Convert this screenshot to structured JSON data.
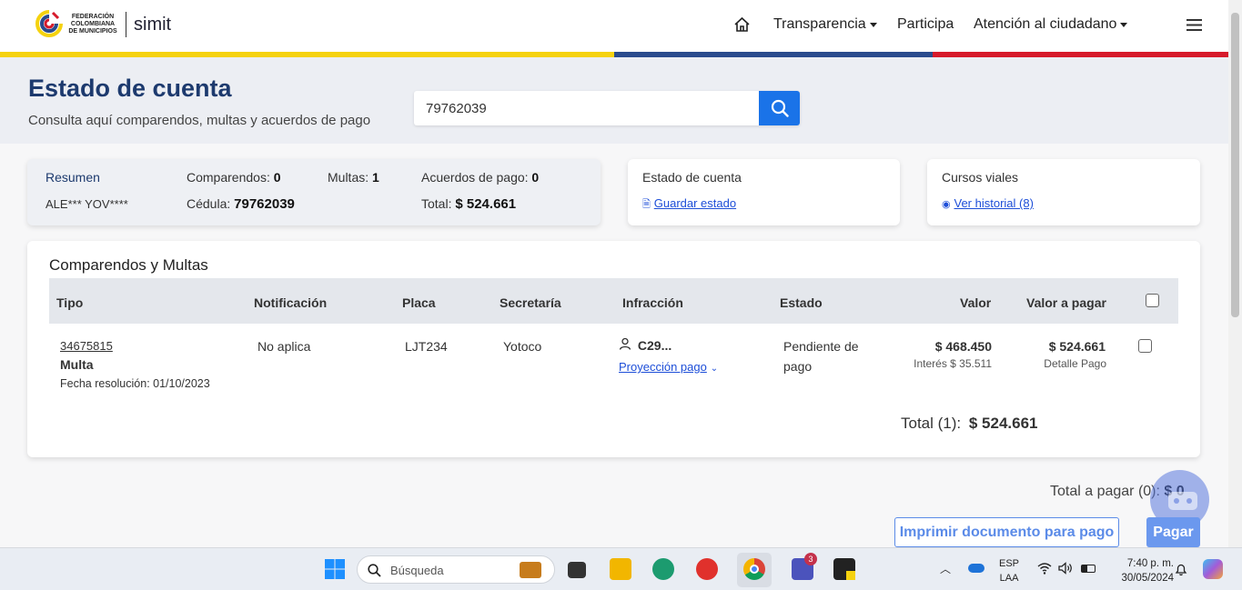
{
  "header": {
    "logo_text": "FEDERACIÓN COLOMBIANA DE MUNICIPIOS",
    "logo_brand": "simit",
    "nav": {
      "home_icon": "home-icon",
      "transparencia": "Transparencia",
      "participa": "Participa",
      "atencion": "Atención al ciudadano",
      "menu_icon": "hamburger-icon"
    }
  },
  "colors": {
    "stripe_yellow": "#f5d20f",
    "stripe_blue": "#2a4b8d",
    "stripe_red": "#d61a2b",
    "title_blue": "#1d3a6e",
    "accent_blue": "#1a73e8"
  },
  "hero": {
    "title": "Estado de cuenta",
    "subtitle": "Consulta aquí comparendos, multas y acuerdos de pago",
    "search_value": "79762039",
    "search_icon": "search-icon"
  },
  "summary": {
    "resumen_label": "Resumen",
    "name": "ALE*** YOV****",
    "comparendos_label": "Comparendos:",
    "comparendos_value": "0",
    "multas_label": "Multas:",
    "multas_value": "1",
    "acuerdos_label": "Acuerdos de pago:",
    "acuerdos_value": "0",
    "cedula_label": "Cédula:",
    "cedula_value": "79762039",
    "total_label": "Total:",
    "total_value": "$ 524.661"
  },
  "estado_card": {
    "title": "Estado de cuenta",
    "link": "Guardar estado"
  },
  "cursos_card": {
    "title": "Cursos viales",
    "link": "Ver historial (8)"
  },
  "table": {
    "title": "Comparendos y Multas",
    "headers": [
      "Tipo",
      "Notificación",
      "Placa",
      "Secretaría",
      "Infracción",
      "Estado",
      "Valor",
      "Valor a pagar"
    ],
    "row": {
      "id": "34675815",
      "tipo": "Multa",
      "fecha": "Fecha resolución: 01/10/2023",
      "notificacion": "No aplica",
      "placa": "LJT234",
      "secretaria": "Yotoco",
      "infraccion": "C29...",
      "proyeccion": "Proyección pago",
      "estado_line1": "Pendiente de",
      "estado_line2": "pago",
      "valor": "$ 468.450",
      "interes": "Interés $ 35.511",
      "valor_pagar": "$ 524.661",
      "detalle": "Detalle Pago"
    },
    "total_label": "Total (1):",
    "total_value": "$ 524.661"
  },
  "footer": {
    "total_pagar_label": "Total a pagar (0):",
    "total_pagar_value": "$ 0",
    "imprimir": "Imprimir documento para pago",
    "pagar": "Pagar"
  },
  "taskbar": {
    "search_placeholder": "Búsqueda",
    "lang1": "ESP",
    "lang2": "LAA",
    "time": "7:40 p. m.",
    "date": "30/05/2024",
    "teams_badge": "3"
  }
}
